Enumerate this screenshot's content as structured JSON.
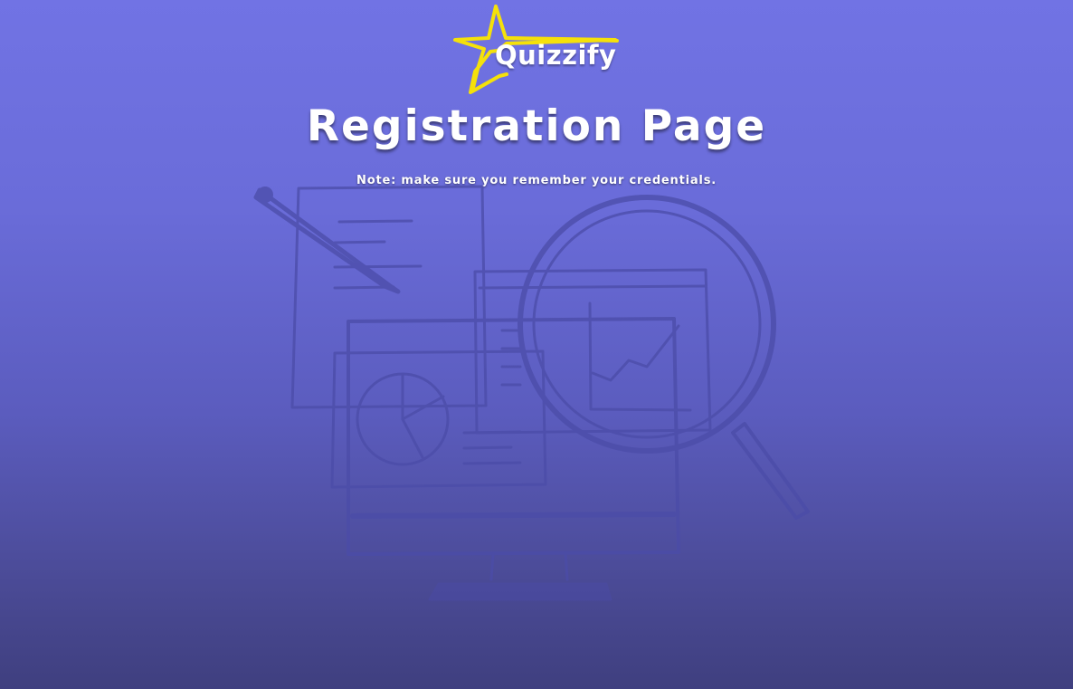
{
  "brand": {
    "name": "Quizzify",
    "logo_icon": "star-icon",
    "star_color": "#f5e10a"
  },
  "header": {
    "title": "Registration Page",
    "note": "Note: make sure you remember your credentials."
  },
  "background": {
    "gradient_top": "#7173e4",
    "gradient_bottom": "#3f3f7f",
    "illustration": "analytics-illustration"
  }
}
